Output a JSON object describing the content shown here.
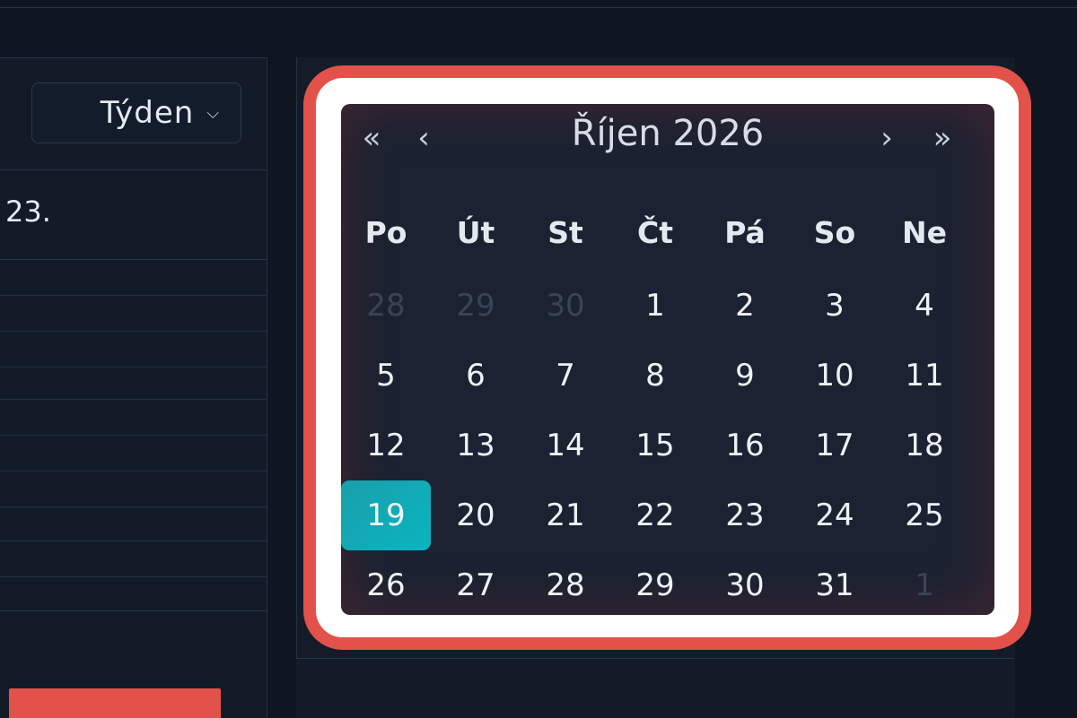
{
  "toolbar": {
    "view_select_label": "Týden"
  },
  "left_panel": {
    "date_label": "23."
  },
  "calendar": {
    "month_title": "Říjen 2026",
    "nav": {
      "prev_year": "«",
      "prev_month": "‹",
      "next_month": "›",
      "next_year": "»"
    },
    "weekdays": [
      "Po",
      "Út",
      "St",
      "Čt",
      "Pá",
      "So",
      "Ne"
    ],
    "weeks": [
      [
        "28",
        "29",
        "30",
        "1",
        "2",
        "3",
        "4"
      ],
      [
        "5",
        "6",
        "7",
        "8",
        "9",
        "10",
        "11"
      ],
      [
        "12",
        "13",
        "14",
        "15",
        "16",
        "17",
        "18"
      ],
      [
        "19",
        "20",
        "21",
        "22",
        "23",
        "24",
        "25"
      ],
      [
        "26",
        "27",
        "28",
        "29",
        "30",
        "31",
        "1"
      ]
    ],
    "outside_month": [
      [
        0,
        0
      ],
      [
        0,
        1
      ],
      [
        0,
        2
      ],
      [
        4,
        6
      ]
    ],
    "selected": [
      3,
      0
    ]
  },
  "colors": {
    "highlight_frame": "#e2524a",
    "selected_day": "#09b5c0",
    "accent_button": "#e2524a"
  }
}
